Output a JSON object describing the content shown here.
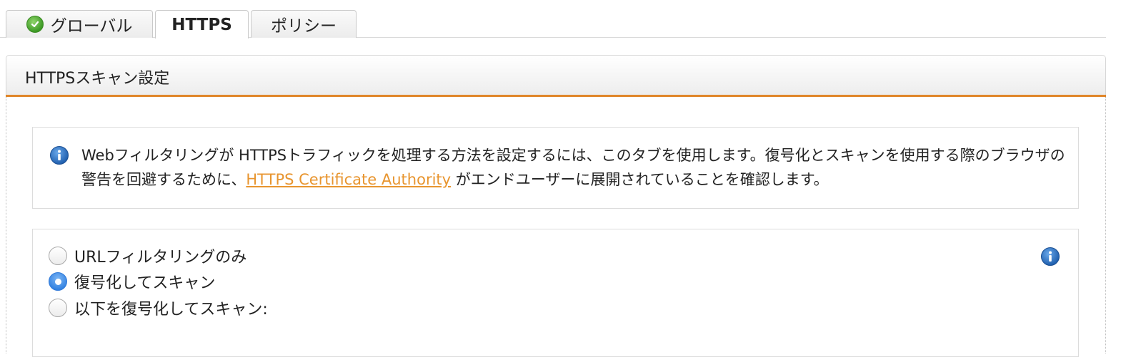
{
  "tabs": [
    {
      "label": "グローバル",
      "icon": "check-circle-icon",
      "active": false
    },
    {
      "label": "HTTPS",
      "active": true
    },
    {
      "label": "ポリシー",
      "active": false
    }
  ],
  "panel": {
    "title": "HTTPSスキャン設定"
  },
  "info": {
    "text_before": "Webフィルタリングが HTTPSトラフィックを処理する方法を設定するには、このタブを使用します。復号化とスキャンを使用する際のブラウザの警告を回避するために、",
    "link_text": "HTTPS Certificate Authority",
    "text_after": " がエンドユーザーに展開されていることを確認します。"
  },
  "scan_options": {
    "selected": "decrypt_and_scan",
    "items": [
      {
        "id": "url_only",
        "label": "URLフィルタリングのみ",
        "checked": false
      },
      {
        "id": "decrypt_and_scan",
        "label": "復号化してスキャン",
        "checked": true
      },
      {
        "id": "decrypt_following",
        "label": "以下を復号化してスキャン:",
        "checked": false
      }
    ]
  },
  "colors": {
    "accent_orange": "#e0862a",
    "link_orange": "#e8952f",
    "info_blue": "#1f5fae",
    "ok_green": "#3d9a25",
    "radio_selected": "#2f7fe0"
  }
}
